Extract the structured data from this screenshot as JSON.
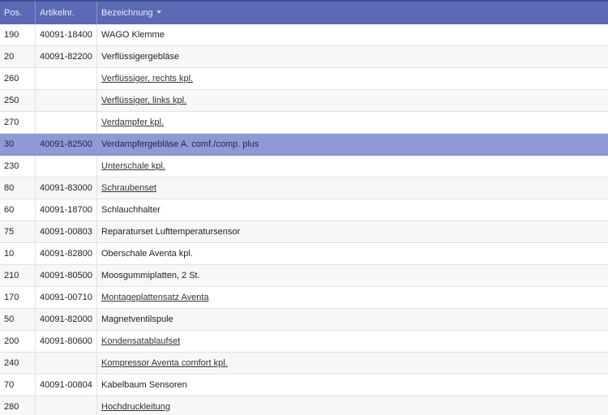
{
  "columns": {
    "pos": "Pos.",
    "artikelnr": "Artikelnr.",
    "bezeichnung": "Bezeichnung"
  },
  "rows": [
    {
      "pos": "190",
      "artikelnr": "40091-18400",
      "bezeichnung": "WAGO Klemme",
      "link": false
    },
    {
      "pos": "20",
      "artikelnr": "40091-82200",
      "bezeichnung": "Verflüssigergebläse",
      "link": false
    },
    {
      "pos": "260",
      "artikelnr": "",
      "bezeichnung": "Verflüssiger, rechts kpl.",
      "link": true
    },
    {
      "pos": "250",
      "artikelnr": "",
      "bezeichnung": "Verflüssiger, links kpl.",
      "link": true
    },
    {
      "pos": "270",
      "artikelnr": "",
      "bezeichnung": "Verdampfer kpl.",
      "link": true
    },
    {
      "pos": "30",
      "artikelnr": "40091-82500",
      "bezeichnung": "Verdampfergebläse A. comf./comp. plus",
      "link": false,
      "selected": true
    },
    {
      "pos": "230",
      "artikelnr": "",
      "bezeichnung": "Unterschale kpl.",
      "link": true
    },
    {
      "pos": "80",
      "artikelnr": "40091-83000",
      "bezeichnung": "Schraubenset",
      "link": true
    },
    {
      "pos": "60",
      "artikelnr": "40091-18700",
      "bezeichnung": "Schlauchhalter",
      "link": false
    },
    {
      "pos": "75",
      "artikelnr": "40091-00803",
      "bezeichnung": "Reparaturset Lufttemperatursensor",
      "link": false
    },
    {
      "pos": "10",
      "artikelnr": "40091-82800",
      "bezeichnung": "Oberschale Aventa kpl.",
      "link": false
    },
    {
      "pos": "210",
      "artikelnr": "40091-80500",
      "bezeichnung": "Moosgummiplatten, 2 St.",
      "link": false
    },
    {
      "pos": "170",
      "artikelnr": "40091-00710",
      "bezeichnung": "Montageplattensatz Aventa",
      "link": true
    },
    {
      "pos": "50",
      "artikelnr": "40091-82000",
      "bezeichnung": "Magnetventilspule",
      "link": false
    },
    {
      "pos": "200",
      "artikelnr": "40091-80600",
      "bezeichnung": "Kondensatablaufset",
      "link": true
    },
    {
      "pos": "240",
      "artikelnr": "",
      "bezeichnung": "Kompressor Aventa comfort kpl.",
      "link": true
    },
    {
      "pos": "70",
      "artikelnr": "40091-00804",
      "bezeichnung": "Kabelbaum Sensoren",
      "link": false
    },
    {
      "pos": "280",
      "artikelnr": "",
      "bezeichnung": "Hochdruckleitung",
      "link": true
    }
  ],
  "colors": {
    "header_bg": "#5b6ab4",
    "selected_row_bg": "#8e99d6"
  },
  "icons": {
    "sort": "sort-descending-icon"
  }
}
